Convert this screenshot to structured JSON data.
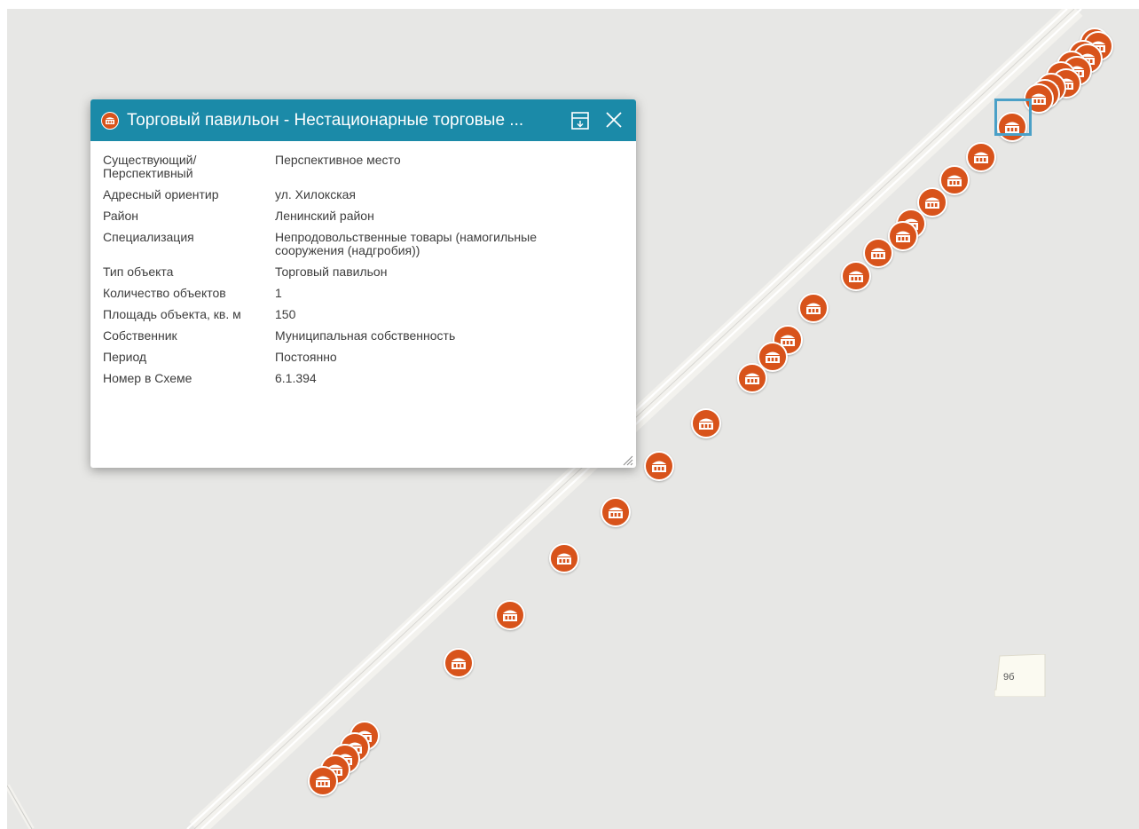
{
  "popup": {
    "title": "Торговый павильон - Нестационарные торговые ...",
    "rows": [
      {
        "key": "Существующий/ Перспективный",
        "value": "Перспективное место"
      },
      {
        "key": "Адресный ориентир",
        "value": "ул. Хилокская"
      },
      {
        "key": "Район",
        "value": "Ленинский район"
      },
      {
        "key": "Специализация",
        "value": "Непродовольственные товары (намогильные сооружения (надгробия))"
      },
      {
        "key": "Тип объекта",
        "value": "Торговый павильон"
      },
      {
        "key": "Количество объектов",
        "value": "1"
      },
      {
        "key": "Площадь объекта, кв. м",
        "value": "150"
      },
      {
        "key": "Собственник",
        "value": "Муниципальная собственность"
      },
      {
        "key": "Период",
        "value": "Постоянно"
      },
      {
        "key": "Номер в Схеме",
        "value": "6.1.394"
      }
    ]
  },
  "map": {
    "building_label": "9б",
    "marker_icon": "market-pavilion-icon",
    "marker_color": "#d8531b",
    "header_color": "#1b8aa8",
    "selection_color": "#4aa0c7",
    "marker_count": 34
  }
}
